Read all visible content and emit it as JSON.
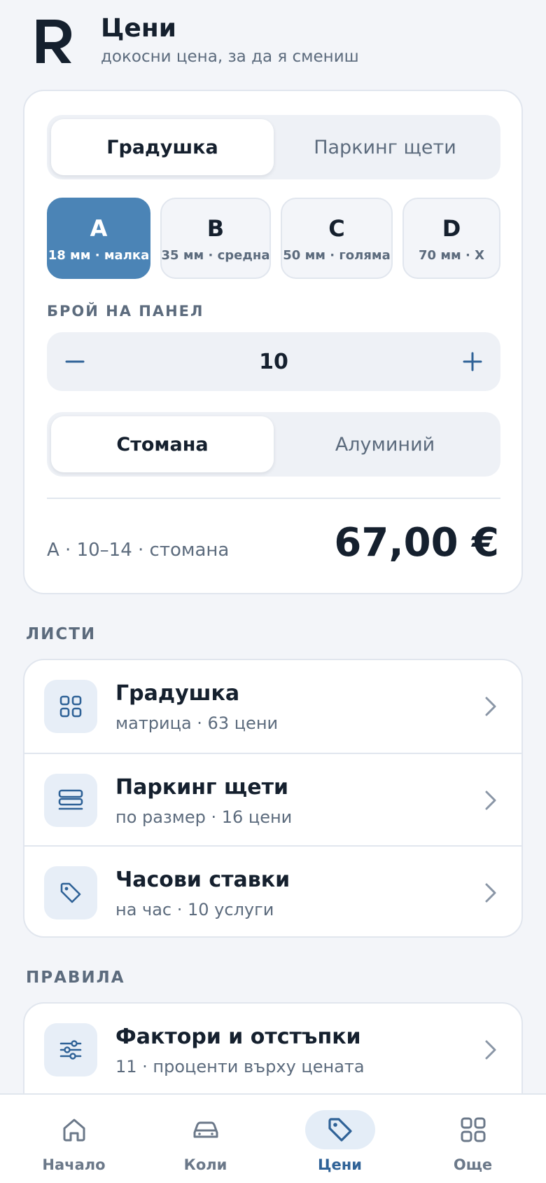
{
  "header": {
    "title": "Цени",
    "subtitle": "докосни цена, за да я смениш"
  },
  "calculator": {
    "damage_types": [
      {
        "label": "Градушка",
        "active": true
      },
      {
        "label": "Паркинг щети",
        "active": false
      }
    ],
    "sizes": [
      {
        "letter": "A",
        "desc": "18 мм · малка",
        "active": true
      },
      {
        "letter": "B",
        "desc": "35 мм · средна",
        "active": false
      },
      {
        "letter": "C",
        "desc": "50 мм · голяма",
        "active": false
      },
      {
        "letter": "D",
        "desc": "70 мм · X",
        "active": false
      }
    ],
    "panel_label": "БРОЙ НА ПАНЕЛ",
    "panel_count": "10",
    "materials": [
      {
        "label": "Стомана",
        "active": true
      },
      {
        "label": "Алуминий",
        "active": false
      }
    ],
    "summary": "A · 10–14 · стомана",
    "price": "67,00 €"
  },
  "lists": {
    "section_label": "ЛИСТИ",
    "items": [
      {
        "title": "Градушка",
        "subtitle": "матрица · 63 цени",
        "icon": "grid-icon"
      },
      {
        "title": "Паркинг щети",
        "subtitle": "по размер · 16 цени",
        "icon": "layers-icon"
      },
      {
        "title": "Часови ставки",
        "subtitle": "на час · 10 услуги",
        "icon": "tag-icon"
      }
    ]
  },
  "rules": {
    "section_label": "ПРАВИЛА",
    "items": [
      {
        "title": "Фактори и отстъпки",
        "subtitle": "11 · проценти върху цената",
        "icon": "sliders-icon"
      }
    ]
  },
  "nav": {
    "items": [
      {
        "label": "Начало",
        "icon": "home-icon",
        "active": false
      },
      {
        "label": "Коли",
        "icon": "car-icon",
        "active": false
      },
      {
        "label": "Цени",
        "icon": "tag-icon",
        "active": true
      },
      {
        "label": "Още",
        "icon": "apps-icon",
        "active": false
      }
    ]
  },
  "colors": {
    "accent": "#4b84b6",
    "text": "#15202e",
    "muted": "#5c6b7d",
    "background": "#f3f5f9"
  }
}
